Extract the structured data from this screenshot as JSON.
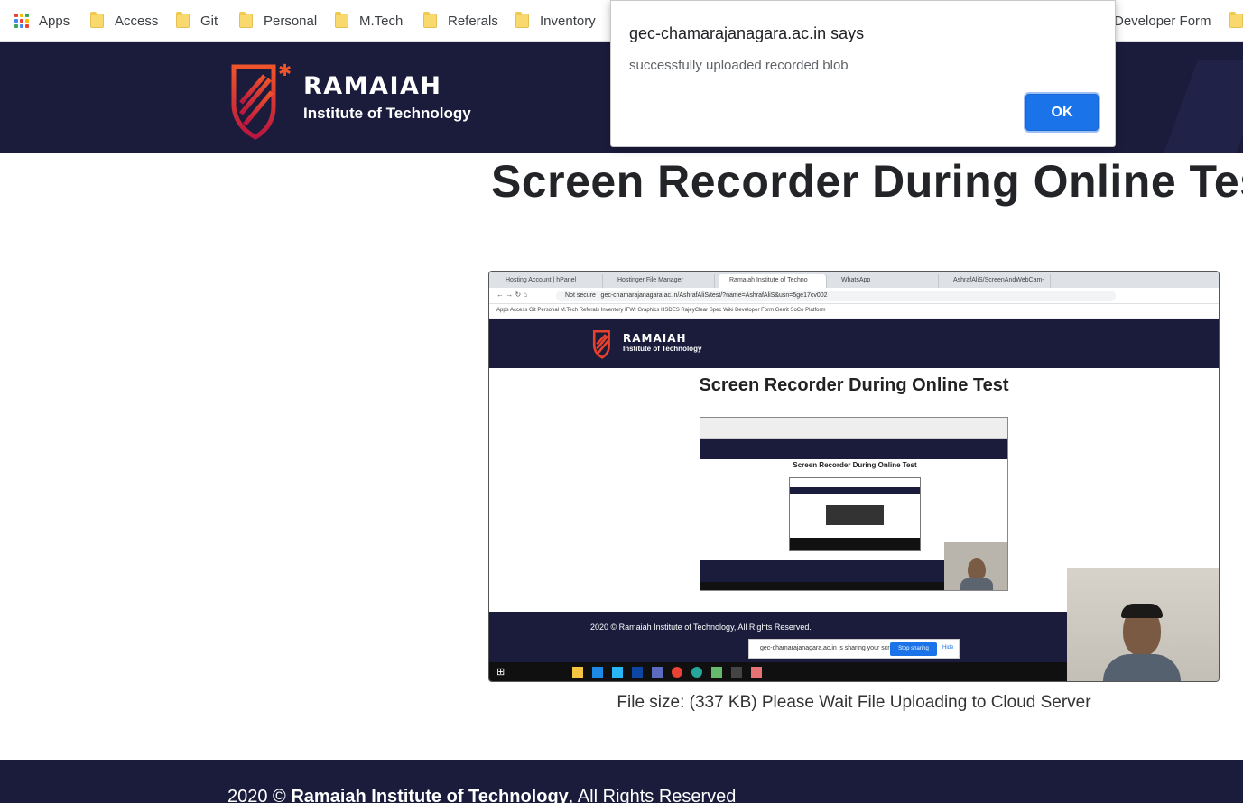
{
  "bookmarks": {
    "apps_label": "Apps",
    "items": [
      "Access",
      "Git",
      "Personal",
      "M.Tech",
      "Referals",
      "Inventory",
      "Developer Form"
    ]
  },
  "header": {
    "logo_name": "RAMAIAH",
    "logo_sub": "Institute of Technology"
  },
  "main": {
    "title": "Screen Recorder During Online Test",
    "file_size_text": "File size: (337 KB) Please Wait File Uploading to Cloud Server"
  },
  "video": {
    "tabs": [
      "Hosting Account | hPanel",
      "Hostinger File Manager",
      "Ramaiah Institute of Techno",
      "WhatsApp",
      "AshrafAliS/ScreenAndWebCam-"
    ],
    "url": "Not secure  |  gec-chamarajanagara.ac.in/AshrafAliS/test/?name=AshrafAliS&usn=5ge17cv002",
    "bookmarks_text": "Apps    Access    Git    Personal    M.Tech    Referals    Inventory    IFWI    Graphics    HSDES RajeyClear    Spec    Wiki    Developer Form    Gerrit    SoCo Platform",
    "logo_name": "RAMAIAH",
    "logo_sub": "Institute of Technology",
    "title": "Screen Recorder During Online Test",
    "inner_title": "Screen Recorder During Online Test",
    "footer_text": "2020 © Ramaiah Institute of Technology, All Rights Reserved.",
    "share_text": "gec-chamarajanagara.ac.in is sharing your screen.",
    "stop_label": "Stop sharing",
    "hide_label": "Hide"
  },
  "footer": {
    "year": "2020 ©",
    "org": "Ramaiah Institute of Technology",
    "suffix": ", All Rights Reserved"
  },
  "alert": {
    "origin": "gec-chamarajanagara.ac.in says",
    "message": "successfully uploaded recorded blob",
    "ok_label": "OK"
  },
  "colors": {
    "brand_navy": "#1b1c3c",
    "accent_blue": "#1a73e8",
    "logo_red": "#e8412c"
  }
}
